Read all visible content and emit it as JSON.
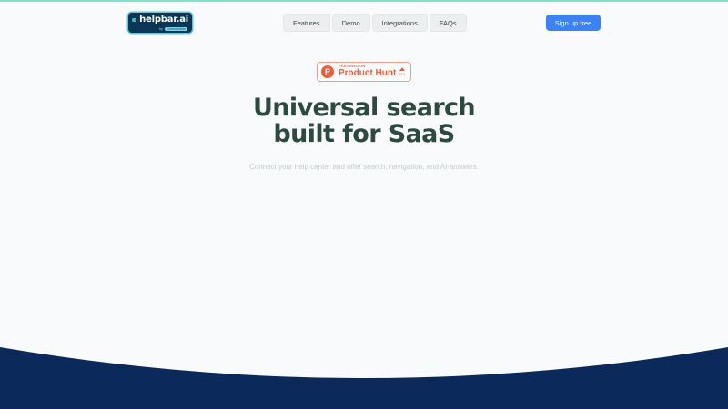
{
  "header": {
    "logo": {
      "name": "helpbar.ai",
      "by": "by",
      "parent": "Commandbar"
    },
    "nav": [
      {
        "label": "Features"
      },
      {
        "label": "Demo"
      },
      {
        "label": "Integrations"
      },
      {
        "label": "FAQs"
      }
    ],
    "cta": {
      "label": "Sign up free"
    }
  },
  "badge": {
    "featured": "FEATURED ON",
    "name": "Product Hunt",
    "votes": "823"
  },
  "hero": {
    "title_line1": "Universal search",
    "title_line2": "built for SaaS",
    "subtitle": "Connect your help center and offer search, navigation, and AI-answers."
  },
  "colors": {
    "accent": "#3b82f6",
    "heading": "#2c4a3e",
    "footer": "#0b2a5b",
    "product_hunt": "#f25a3b"
  },
  "icons": [
    "helpbar-logo-icon",
    "product-hunt-logo-icon",
    "upvote-arrow-icon"
  ]
}
